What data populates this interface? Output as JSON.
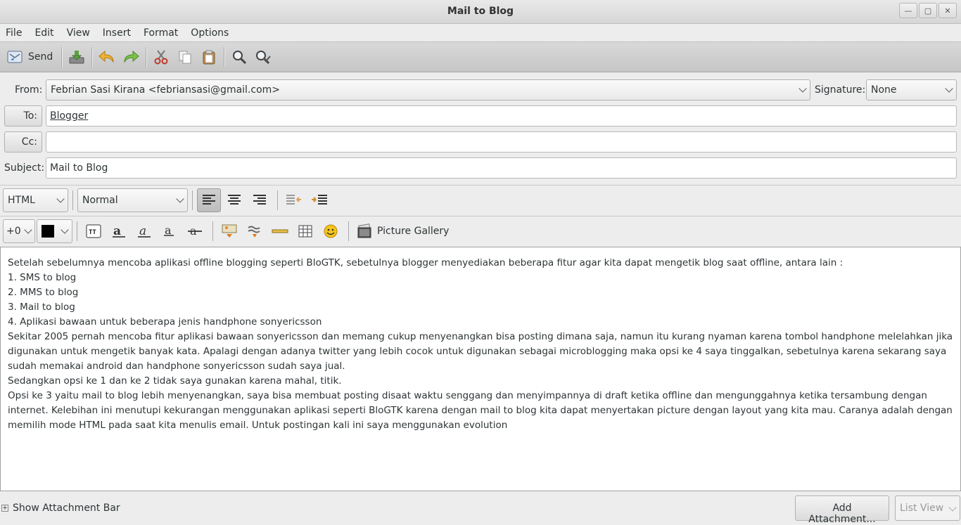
{
  "window": {
    "title": "Mail to Blog"
  },
  "menu": [
    "File",
    "Edit",
    "View",
    "Insert",
    "Format",
    "Options"
  ],
  "toolbar": {
    "send_label": "Send"
  },
  "header": {
    "from_label": "From:",
    "from_value": "Febrian Sasi Kirana <febriansasi@gmail.com>",
    "signature_label": "Signature:",
    "signature_value": "None",
    "to_label": "To:",
    "to_value": "Blogger",
    "cc_label": "Cc:",
    "cc_value": "",
    "subject_label": "Subject:",
    "subject_value": "Mail to Blog"
  },
  "format": {
    "mode": "HTML",
    "paragraph_style": "Normal",
    "font_size": "+0",
    "text_color": "#000000",
    "picture_gallery_label": "Picture Gallery"
  },
  "body": [
    "Setelah sebelumnya mencoba aplikasi offline blogging seperti BloGTK, sebetulnya blogger menyediakan beberapa fitur agar kita dapat mengetik blog saat offline, antara lain :",
    "1. SMS to blog",
    "2. MMS to blog",
    "3. Mail to blog",
    "4. Aplikasi bawaan untuk beberapa jenis handphone sonyericsson",
    "Sekitar 2005 pernah mencoba fitur aplikasi bawaan sonyericsson dan memang cukup menyenangkan bisa posting dimana saja, namun itu kurang nyaman karena tombol handphone melelahkan jika digunakan untuk mengetik banyak kata. Apalagi dengan adanya twitter yang lebih cocok untuk digunakan sebagai microblogging maka opsi ke 4 saya tinggalkan, sebetulnya karena sekarang saya sudah memakai android dan handphone sonyericsson sudah saya jual.",
    "Sedangkan opsi ke 1 dan ke 2 tidak saya gunakan karena mahal, titik.",
    "Opsi ke 3 yaitu mail to blog lebih menyenangkan, saya bisa membuat posting disaat waktu senggang dan menyimpannya di draft ketika offline dan mengunggahnya ketika tersambung dengan internet. Kelebihan ini menutupi kekurangan menggunakan aplikasi seperti BloGTK karena dengan mail to blog kita dapat menyertakan picture dengan layout yang kita mau. Caranya adalah dengan memilih mode HTML pada saat kita menulis email. Untuk postingan kali ini saya menggunakan evolution"
  ],
  "status": {
    "attachment_bar_label": "Show Attachment Bar",
    "add_attachment_label": "Add Attachment...",
    "view_mode": "List View"
  }
}
